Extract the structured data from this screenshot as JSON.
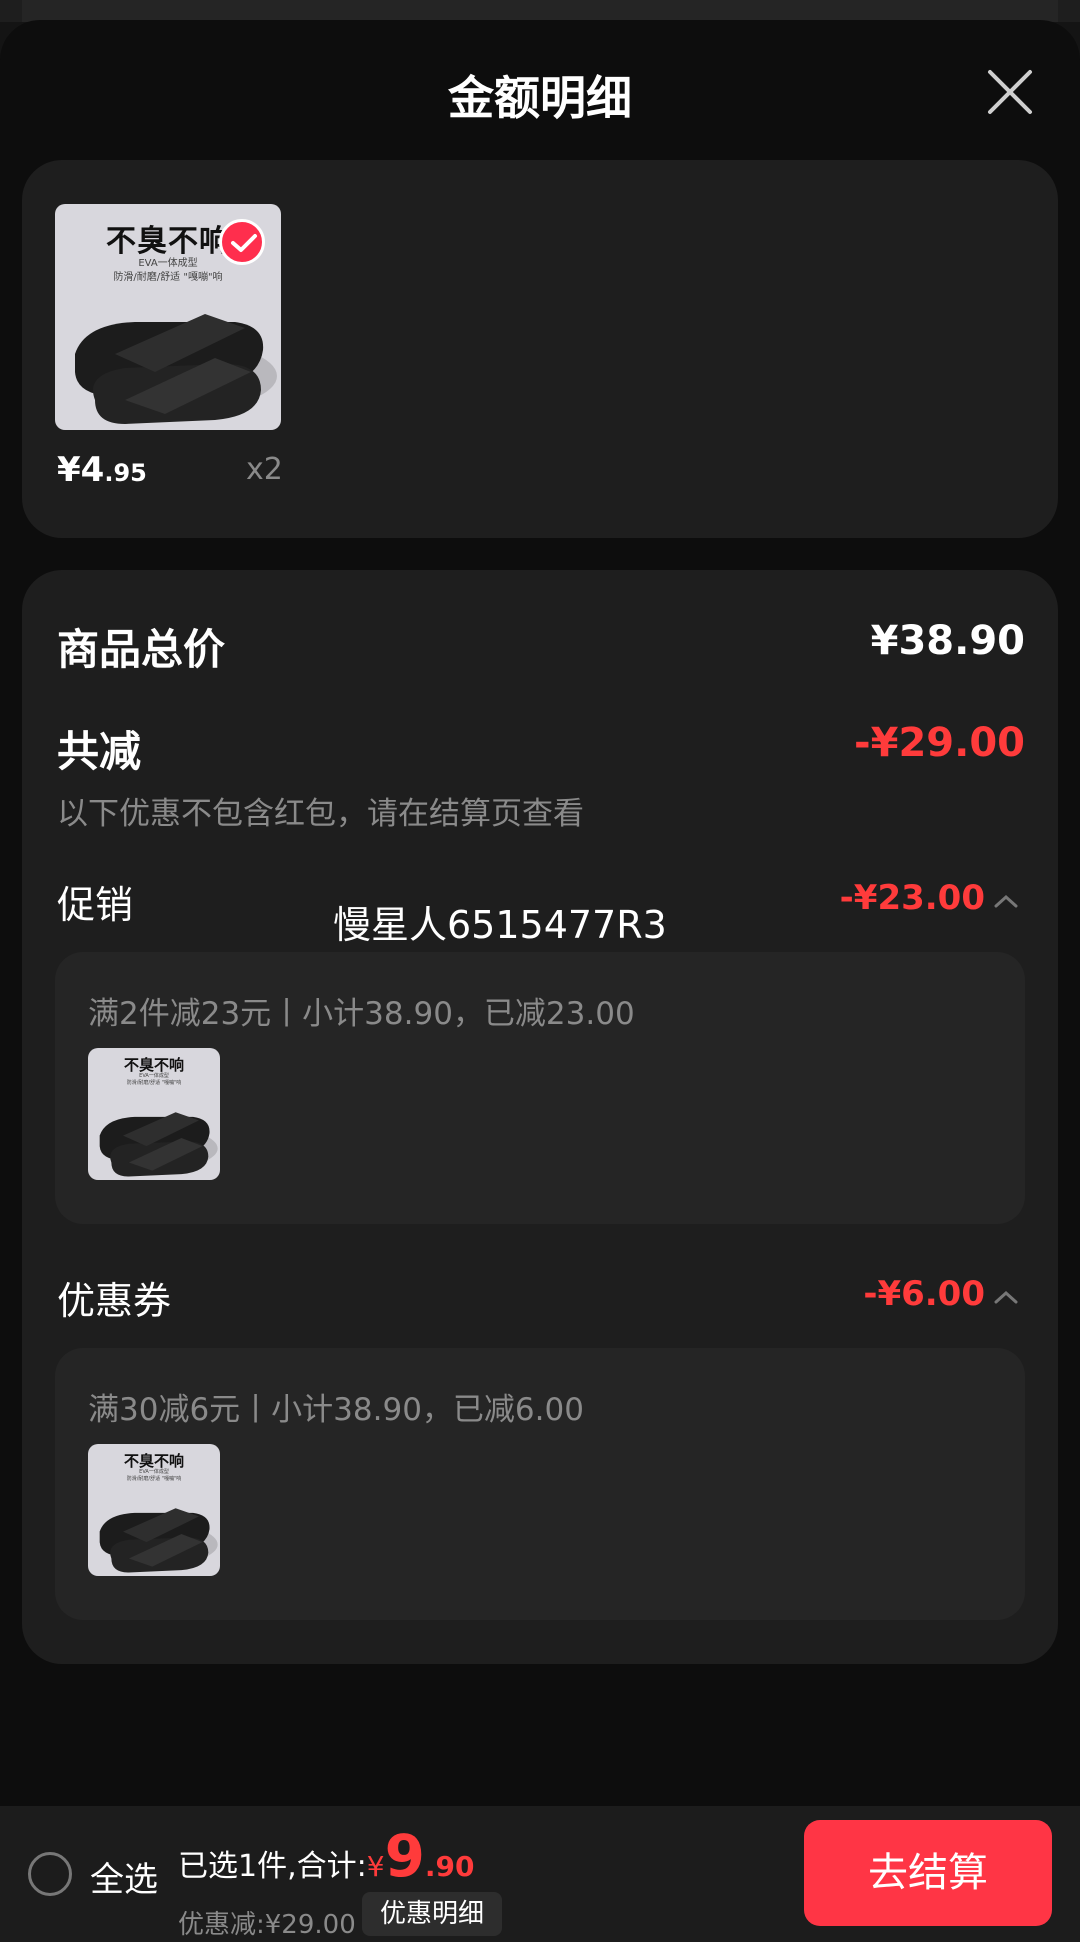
{
  "header": {
    "title": "金额明细"
  },
  "product": {
    "image_text": {
      "title": "不臭不响",
      "line1": "EVA一体成型",
      "line2": "防滑/耐磨/舒适 \"嘎嘣\"响"
    },
    "price_int": "¥4",
    "price_dec": ".95",
    "quantity": "x2",
    "selected": true
  },
  "breakdown": {
    "total_label": "商品总价",
    "total_value": "¥38.90",
    "reduce_label": "共减",
    "reduce_value": "-¥29.00",
    "note": "以下优惠不包含红包，请在结算页查看",
    "promotion": {
      "label": "促销",
      "amount": "-¥23.00",
      "detail": "满2件减23元丨小计38.90，已减23.00"
    },
    "coupon": {
      "label": "优惠券",
      "amount": "-¥6.00",
      "detail": "满30减6元丨小计38.90，已减6.00"
    }
  },
  "watermark": "慢星人6515477R3",
  "bottom_bar": {
    "select_all": "全选",
    "summary_prefix": "已选1件,合计:",
    "currency": "¥",
    "total_int": "9",
    "total_dec": ".90",
    "discount": "优惠减:¥29.00",
    "detail_button": "优惠明细",
    "checkout": "去结算"
  },
  "colors": {
    "background": "#0d0d0d",
    "card": "#1e1e1e",
    "subcard": "#252525",
    "accent_red": "#ff3b3b",
    "checkout_button": "#ff3545",
    "muted_text": "#8a8a8a"
  },
  "icons": [
    "close-icon",
    "checkmark-icon",
    "chevron-up-icon",
    "radio-circle-icon"
  ]
}
